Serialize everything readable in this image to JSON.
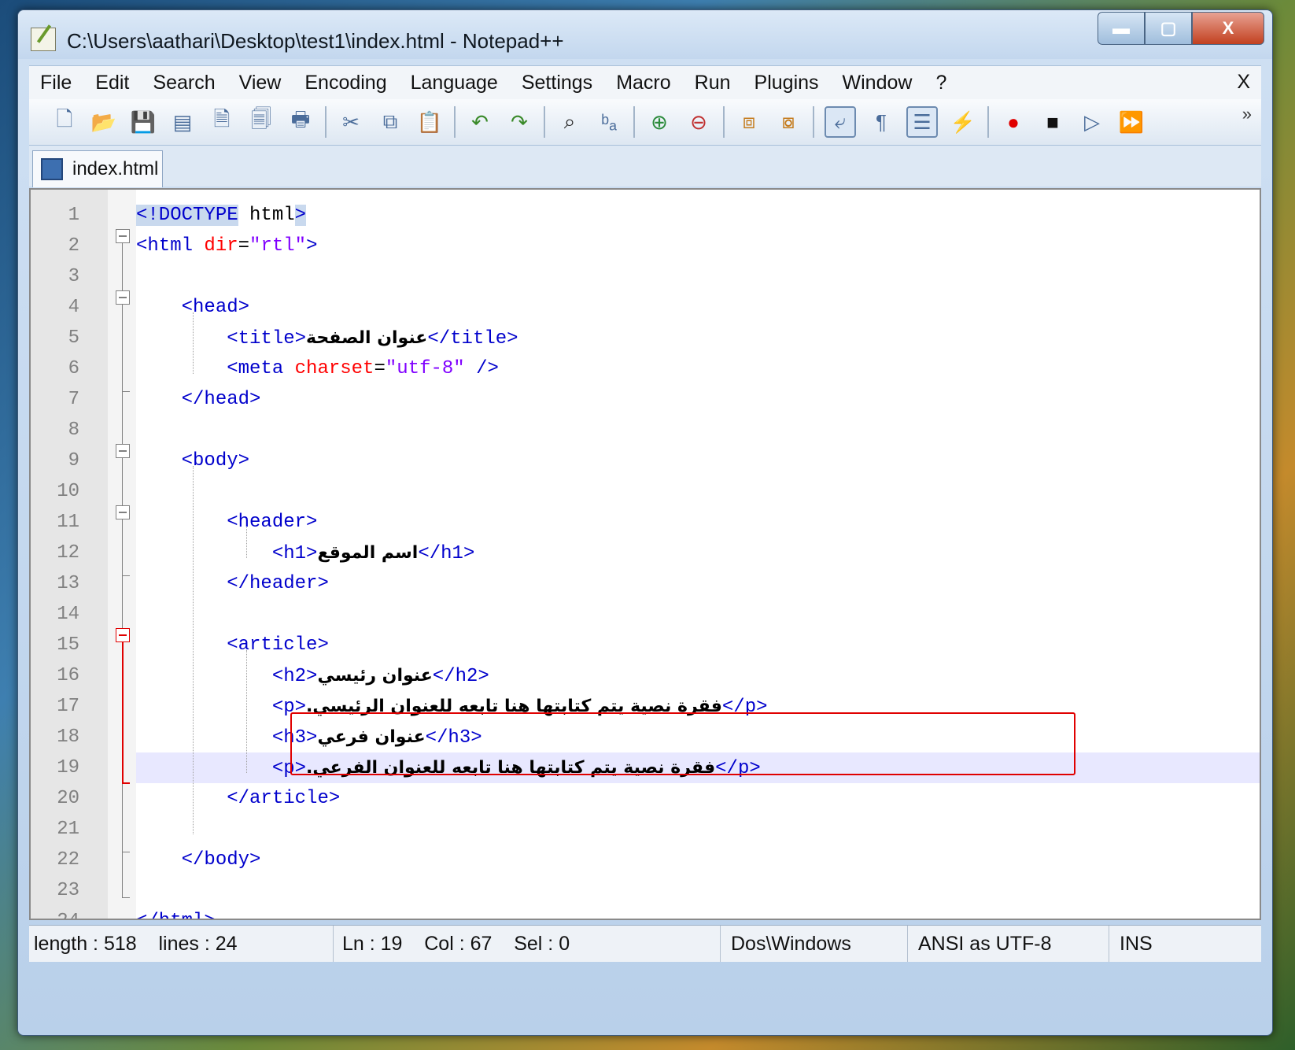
{
  "window": {
    "title": "C:\\Users\\aathari\\Desktop\\test1\\index.html - Notepad++",
    "controls": {
      "minimize": "▬",
      "maximize": "▢",
      "close": "X"
    }
  },
  "menu": {
    "items": [
      "File",
      "Edit",
      "Search",
      "View",
      "Encoding",
      "Language",
      "Settings",
      "Macro",
      "Run",
      "Plugins",
      "Window",
      "?"
    ],
    "close": "X"
  },
  "toolbar": {
    "icons": [
      "new-file-icon",
      "open-file-icon",
      "save-icon",
      "save-all-icon",
      "close-icon",
      "close-all-icon",
      "print-icon",
      "cut-icon",
      "copy-icon",
      "paste-icon",
      "undo-icon",
      "redo-icon",
      "find-icon",
      "replace-icon",
      "zoom-in-icon",
      "zoom-out-icon",
      "sync-vertical-icon",
      "sync-horizontal-icon",
      "word-wrap-icon",
      "show-all-chars-icon",
      "indent-guide-icon",
      "user-defined-language-icon",
      "record-macro-icon",
      "stop-recording-icon",
      "play-macro-icon",
      "run-macro-multiple-icon"
    ],
    "more": "»"
  },
  "tab": {
    "label": "index.html"
  },
  "editor": {
    "current_line": 19,
    "lines": [
      {
        "n": "1",
        "code": "<!DOCTYPE html>"
      },
      {
        "n": "2",
        "code": "<html dir=\"rtl\">"
      },
      {
        "n": "3",
        "code": ""
      },
      {
        "n": "4",
        "code": "    <head>"
      },
      {
        "n": "5",
        "code": "        <title>عنوان الصفحة</title>"
      },
      {
        "n": "6",
        "code": "        <meta charset=\"utf-8\" />"
      },
      {
        "n": "7",
        "code": "    </head>"
      },
      {
        "n": "8",
        "code": ""
      },
      {
        "n": "9",
        "code": "    <body>"
      },
      {
        "n": "10",
        "code": ""
      },
      {
        "n": "11",
        "code": "        <header>"
      },
      {
        "n": "12",
        "code": "            <h1>اسم الموقع</h1>"
      },
      {
        "n": "13",
        "code": "        </header>"
      },
      {
        "n": "14",
        "code": ""
      },
      {
        "n": "15",
        "code": "        <article>"
      },
      {
        "n": "16",
        "code": "            <h2>عنوان رئيسي</h2>"
      },
      {
        "n": "17",
        "code": "            <p>فقرة نصية يتم كتابتها هنا تابعه للعنوان الرئيسي.</p>"
      },
      {
        "n": "18",
        "code": "            <h3>عنوان فرعي</h3>"
      },
      {
        "n": "19",
        "code": "            <p>فقرة نصية يتم كتابتها هنا تابعه للعنوان الفرعي.</p>"
      },
      {
        "n": "20",
        "code": "        </article>"
      },
      {
        "n": "21",
        "code": ""
      },
      {
        "n": "22",
        "code": "    </body>"
      },
      {
        "n": "23",
        "code": ""
      },
      {
        "n": "24",
        "code": "</html>"
      }
    ]
  },
  "status": {
    "length": "length : 518",
    "lines": "lines : 24",
    "ln": "Ln : 19",
    "col": "Col : 67",
    "sel": "Sel : 0",
    "eol": "Dos\\Windows",
    "encoding": "ANSI as UTF-8",
    "mode": "INS"
  },
  "colors": {
    "tag": "#0000cc",
    "attribute": "#ff0000",
    "value": "#8000ff",
    "annotation": "#e00000"
  }
}
